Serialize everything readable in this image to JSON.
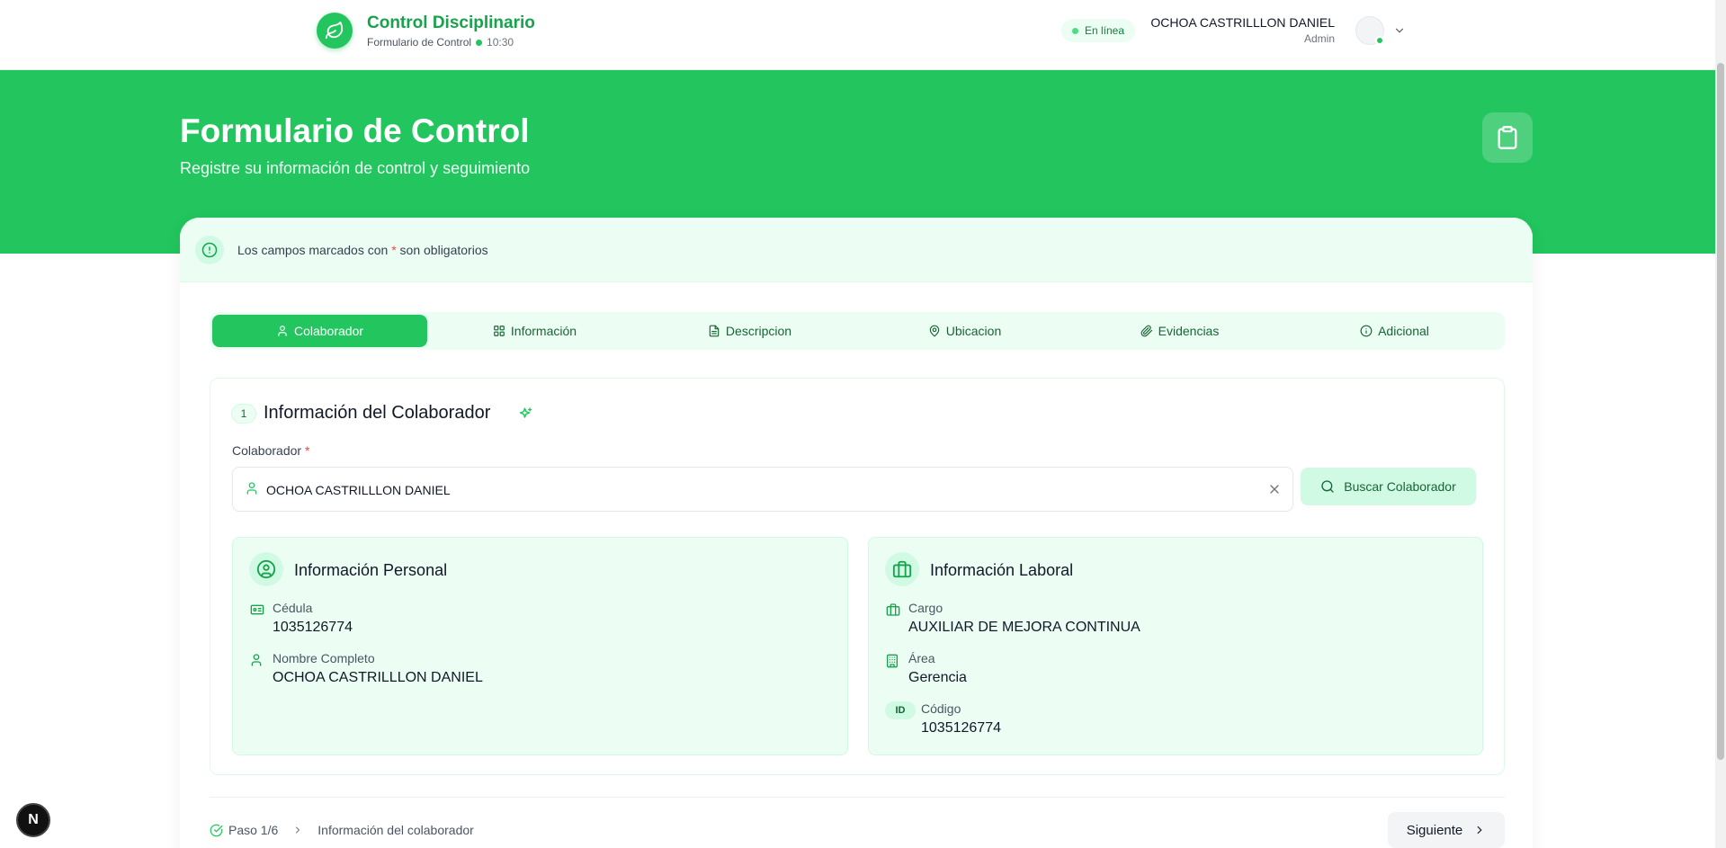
{
  "header": {
    "brand_title": "Control Disciplinario",
    "brand_subtitle": "Formulario de Control",
    "time": "10:30",
    "status": "En línea",
    "user_name": "OCHOA CASTRILLLON DANIEL",
    "user_role": "Admin"
  },
  "hero": {
    "title": "Formulario de Control",
    "subtitle": "Registre su información de control y seguimiento"
  },
  "notice": {
    "text_before": "Los campos marcados con",
    "required_mark": "*",
    "text_after": "son obligatorios"
  },
  "tabs": [
    {
      "label": "Colaborador",
      "icon": "user-icon",
      "active": true
    },
    {
      "label": "Información",
      "icon": "grid-icon",
      "active": false
    },
    {
      "label": "Descripcion",
      "icon": "document-icon",
      "active": false
    },
    {
      "label": "Ubicacion",
      "icon": "map-pin-icon",
      "active": false
    },
    {
      "label": "Evidencias",
      "icon": "paperclip-icon",
      "active": false
    },
    {
      "label": "Adicional",
      "icon": "info-icon",
      "active": false
    }
  ],
  "section": {
    "step_number": "1",
    "title": "Información del Colaborador",
    "field_label": "Colaborador",
    "required_mark": "*",
    "field_value": "OCHOA CASTRILLLON DANIEL",
    "search_button": "Buscar Colaborador"
  },
  "personal": {
    "title": "Información Personal",
    "fields": [
      {
        "label": "Cédula",
        "value": "1035126774",
        "icon": "id-card-icon"
      },
      {
        "label": "Nombre Completo",
        "value": "OCHOA CASTRILLLON DANIEL",
        "icon": "user-icon"
      }
    ]
  },
  "laboral": {
    "title": "Información Laboral",
    "fields": [
      {
        "label": "Cargo",
        "value": "AUXILIAR DE MEJORA CONTINUA",
        "icon": "briefcase-icon"
      },
      {
        "label": "Área",
        "value": "Gerencia",
        "icon": "building-icon"
      },
      {
        "label": "Código",
        "value": "1035126774",
        "icon": "id-badge"
      }
    ],
    "id_badge_text": "ID"
  },
  "footer": {
    "step": "Paso 1/6",
    "step_name": "Información del colaborador",
    "next_button": "Siguiente"
  },
  "dev_badge": "N",
  "colors": {
    "primary": "#22c55e",
    "primary_dark": "#16a34a",
    "light": "#ecfdf3",
    "required": "#ef4444"
  }
}
